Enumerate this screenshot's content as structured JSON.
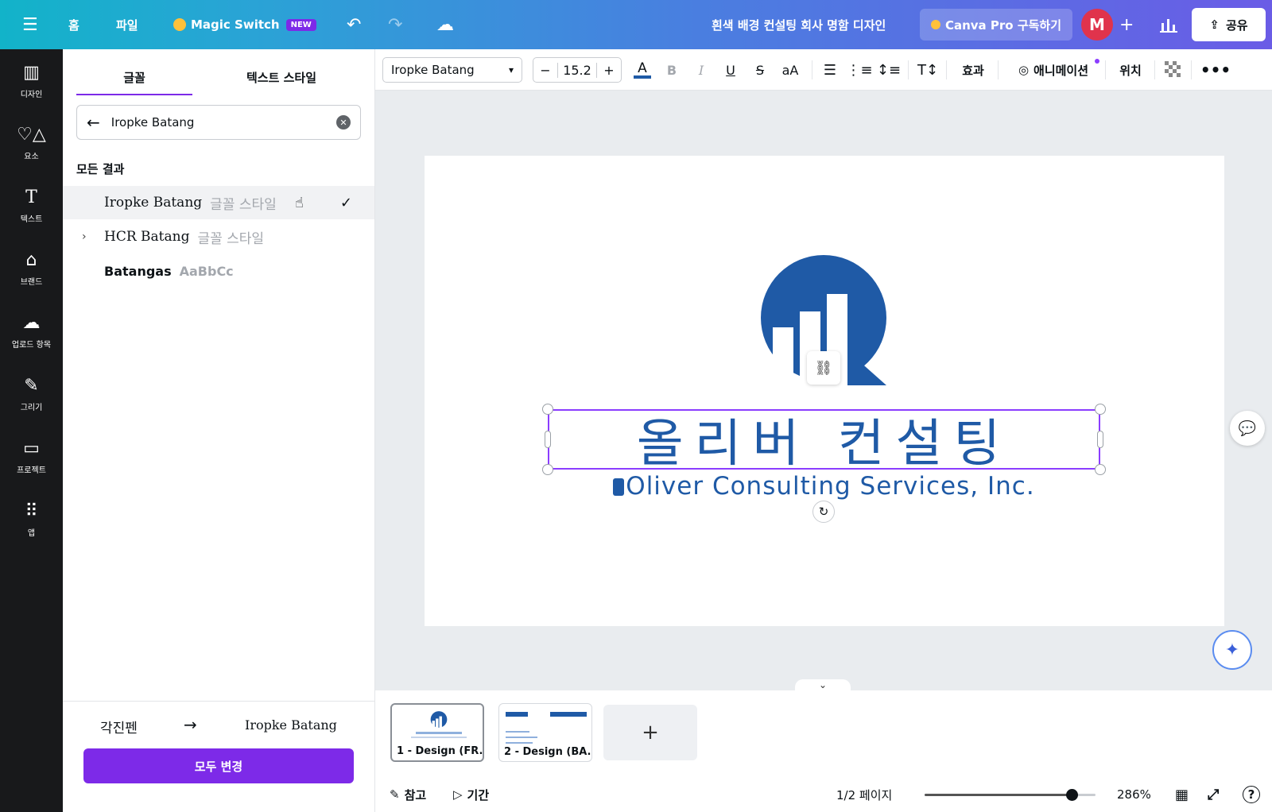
{
  "topbar": {
    "menu_icon": "hamburger-icon",
    "home": "홈",
    "file": "파일",
    "magic_switch": "Magic Switch",
    "new_badge": "NEW",
    "undo_icon": "undo-icon",
    "redo_icon": "redo-icon",
    "cloud_icon": "cloud-saved-icon",
    "doc_title": "흰색 배경 컨설팅 회사 명함 디자인",
    "pro_label": "Canva Pro 구독하기",
    "avatar_letter": "M",
    "add_icon": "plus-icon",
    "stats_icon": "bar-chart-icon",
    "share_label": "공유",
    "gradient_start": "#12b3c9",
    "gradient_end": "#6a5ce6"
  },
  "rail": [
    {
      "label": "디자인",
      "icon": "layout-icon"
    },
    {
      "label": "요소",
      "icon": "elements-icon"
    },
    {
      "label": "텍스트",
      "icon": "text-icon"
    },
    {
      "label": "브랜드",
      "icon": "brand-icon"
    },
    {
      "label": "업로드 항목",
      "icon": "upload-icon"
    },
    {
      "label": "그리기",
      "icon": "draw-icon"
    },
    {
      "label": "프로젝트",
      "icon": "folder-icon"
    },
    {
      "label": "앱",
      "icon": "apps-icon"
    }
  ],
  "panel": {
    "tabs": [
      {
        "label": "글꼴",
        "active": true
      },
      {
        "label": "텍스트 스타일",
        "active": false
      }
    ],
    "search_value": "Iropke Batang",
    "section_title": "모든 결과",
    "results": [
      {
        "name": "Iropke Batang",
        "suffix": "글꼴 스타일",
        "selected": true
      },
      {
        "name": "HCR Batang",
        "suffix": "글꼴 스타일",
        "selected": false
      },
      {
        "name": "Batangas",
        "suffix": "AaBbCc",
        "selected": false
      }
    ],
    "replace_from": "각진펜",
    "replace_to": "Iropke Batang",
    "replace_all": "모두 변경",
    "accent": "#7d2ae8"
  },
  "toolbar": {
    "font_name": "Iropke Batang",
    "font_size": "15.2",
    "minus": "−",
    "plus": "+",
    "effects": "효과",
    "animate": "애니메이션",
    "position": "위치",
    "more_icon": "more-icon"
  },
  "canvas": {
    "title_ko": "올리버 컨설팅",
    "title_en": "Oliver Consulting Services, Inc.",
    "brand_color": "#1f5aa6",
    "selection_color": "#8b3dff"
  },
  "pages": [
    {
      "label": "1 - Design (FR...",
      "active": true
    },
    {
      "label": "2 - Design (BA...",
      "active": false
    }
  ],
  "bottom": {
    "notes": "참고",
    "duration": "기간",
    "page_indicator": "1/2 페이지",
    "zoom": "286%",
    "zoom_level": 0.86
  }
}
